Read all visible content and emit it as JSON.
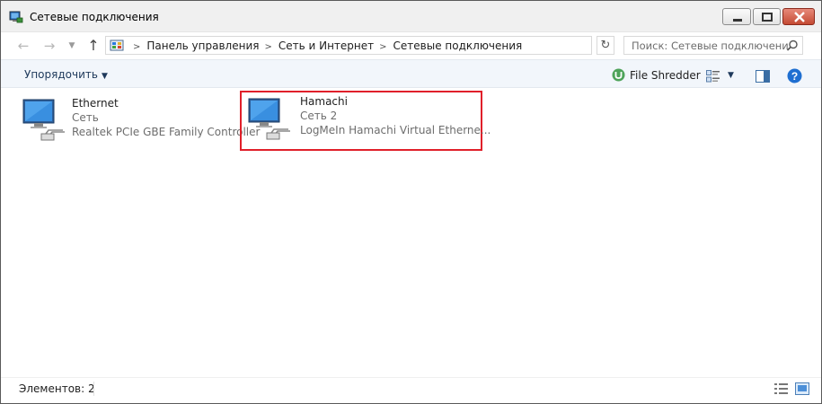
{
  "window": {
    "title": "Сетевые подключения"
  },
  "address": {
    "crumbs": [
      "Панель управления",
      "Сеть и Интернет",
      "Сетевые подключения"
    ]
  },
  "search": {
    "placeholder": "Поиск: Сетевые подключения"
  },
  "toolbar": {
    "organize_label": "Упорядочить",
    "file_shredder_label": "File Shredder"
  },
  "connections": [
    {
      "name": "Ethernet",
      "network": "Сеть",
      "adapter": "Realtek PCIe GBE Family Controller",
      "highlighted": false
    },
    {
      "name": "Hamachi",
      "network": "Сеть  2",
      "adapter": "LogMeIn Hamachi Virtual Etherne...",
      "highlighted": true
    }
  ],
  "status": {
    "item_count": "Элементов: 2"
  },
  "colors": {
    "highlight_border": "#e0202a",
    "toolbar_bg": "#f2f6fb",
    "close_button": "#c44a33"
  },
  "icons": [
    "network-connection-icon",
    "control-panel-icon",
    "search-icon",
    "help-icon",
    "file-shredder-icon",
    "change-view-icon",
    "preview-pane-icon"
  ]
}
